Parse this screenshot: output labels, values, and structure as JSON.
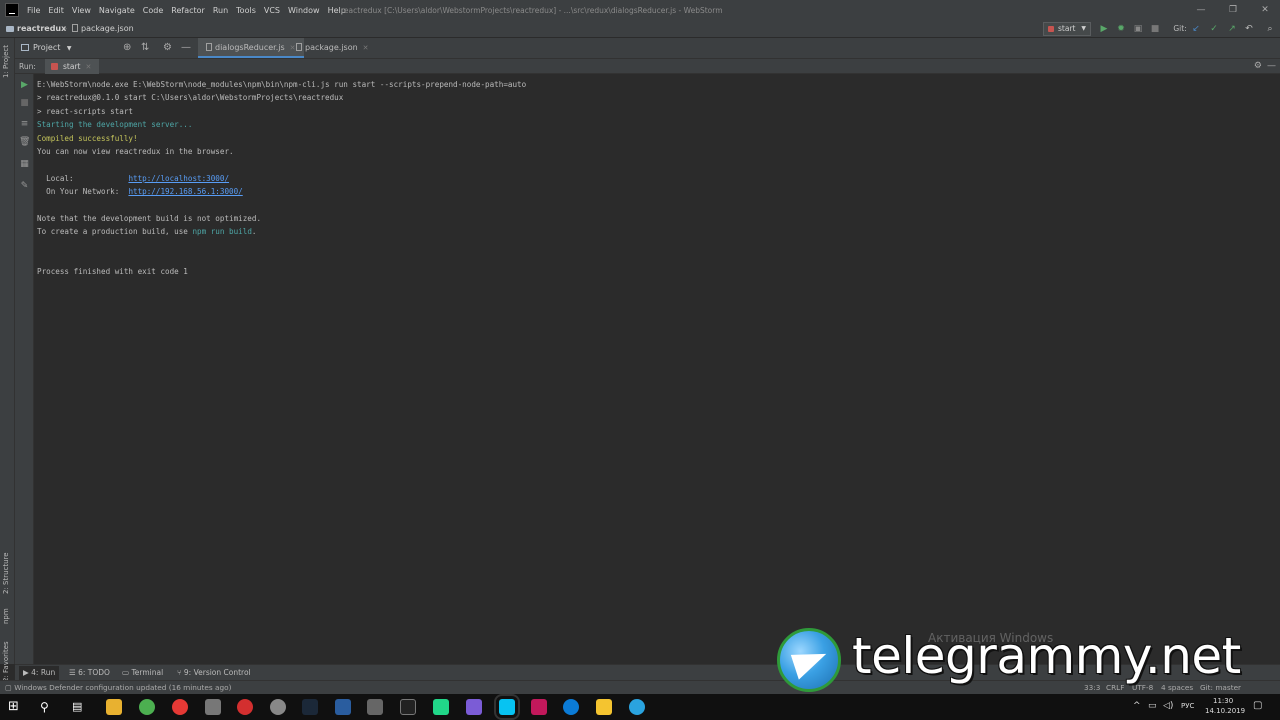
{
  "menubar": {
    "items": [
      "File",
      "Edit",
      "View",
      "Navigate",
      "Code",
      "Refactor",
      "Run",
      "Tools",
      "VCS",
      "Window",
      "Help"
    ],
    "window_title": "reactredux [C:\\Users\\aldor\\WebstormProjects\\reactredux] - ...\\src\\redux\\dialogsReducer.js - WebStorm",
    "min": "—",
    "restore": "❐",
    "close": "✕"
  },
  "navbar": {
    "project": "reactredux",
    "file": "package.json",
    "run_config": "start",
    "git_label": "Git:"
  },
  "left_strip": {
    "project": "1: Project",
    "structure": "2: Structure",
    "npm": "npm",
    "favorites": "2: Favorites"
  },
  "tabbar": {
    "project_dropdown": "Project",
    "tabs": [
      {
        "label": "dialogsReducer.js",
        "active": true
      },
      {
        "label": "package.json",
        "active": false
      }
    ]
  },
  "run": {
    "label": "Run:",
    "tab": "start"
  },
  "console": {
    "lines": [
      "E:\\WebStorm\\node.exe E:\\WebStorm\\node_modules\\npm\\bin\\npm-cli.js run start --scripts-prepend-node-path=auto",
      "> reactredux@0.1.0 start C:\\Users\\aldor\\WebstormProjects\\reactredux",
      "> react-scripts start",
      "Starting the development server...",
      "Compiled successfully!",
      "You can now view reactredux in the browser.",
      "Note that the development build is not optimized.",
      "To create a production build, use ",
      "Process finished with exit code 1"
    ],
    "local_label": "  Local:            ",
    "local_url": "http://localhost:3000/",
    "network_label": "  On Your Network:  ",
    "network_url": "http://192.168.56.1:3000/",
    "build_cmd": "npm run build",
    "build_end": "."
  },
  "bottom_tools": {
    "run": "4: Run",
    "todo": "6: TODO",
    "terminal": "Terminal",
    "vcs": "9: Version Control"
  },
  "statusbar": {
    "message": "Windows Defender configuration updated (16 minutes ago)",
    "position": "33:3",
    "line_sep": "CRLF",
    "encoding": "UTF-8",
    "indent": "4 spaces",
    "git": "Git: master"
  },
  "taskbar": {
    "lang": "РУС",
    "time": "11:30",
    "date": "14.10.2019"
  },
  "watermark": {
    "activate": "Активация Windows",
    "brand": "telegrammy.net"
  },
  "colors": {
    "accent": "#4a88c7",
    "success": "#7ec16e",
    "link": "#589df6"
  }
}
